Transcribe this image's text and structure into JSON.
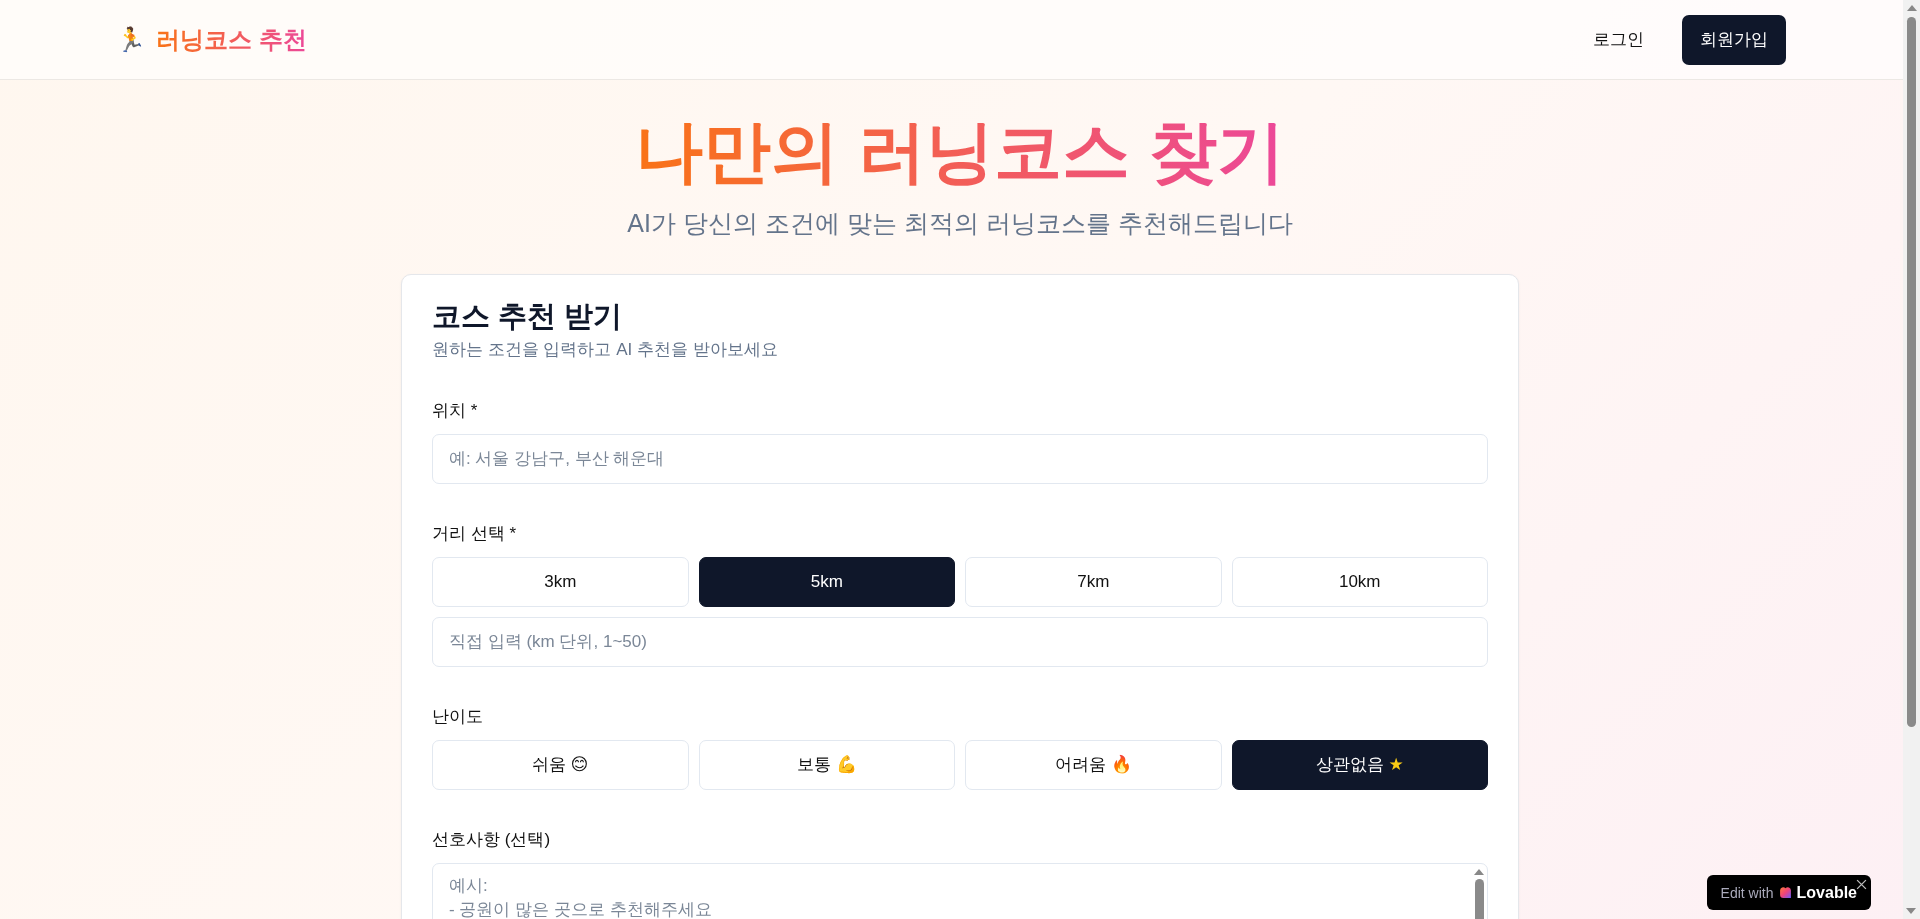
{
  "header": {
    "logo_emoji": "🏃",
    "logo_text": "러닝코스 추천",
    "login": "로그인",
    "signup": "회원가입"
  },
  "hero": {
    "title": "나만의 러닝코스 찾기",
    "subtitle": "AI가 당신의 조건에 맞는 최적의 러닝코스를 추천해드립니다"
  },
  "card": {
    "title": "코스 추천 받기",
    "subtitle": "원하는 조건을 입력하고 AI 추천을 받아보세요",
    "location": {
      "label": "위치 *",
      "placeholder": "예: 서울 강남구, 부산 해운대"
    },
    "distance": {
      "label": "거리 선택 *",
      "options": [
        {
          "label": "3km",
          "selected": false
        },
        {
          "label": "5km",
          "selected": true
        },
        {
          "label": "7km",
          "selected": false
        },
        {
          "label": "10km",
          "selected": false
        }
      ],
      "custom": {
        "placeholder": "직접 입력 (km 단위, 1~50)"
      }
    },
    "difficulty": {
      "label": "난이도",
      "options": [
        {
          "label": "쉬움",
          "emoji": "😊",
          "selected": false
        },
        {
          "label": "보통",
          "emoji": "💪",
          "selected": false
        },
        {
          "label": "어려움",
          "emoji": "🔥",
          "selected": false
        },
        {
          "label": "상관없음",
          "emoji": "★",
          "selected": true
        }
      ]
    },
    "preferences": {
      "label": "선호사항 (선택)",
      "placeholder": "예시:\n- 공원이 많은 곳으로 추천해주세요"
    }
  },
  "badge": {
    "prefix": "Edit with",
    "brand": "Lovable"
  }
}
